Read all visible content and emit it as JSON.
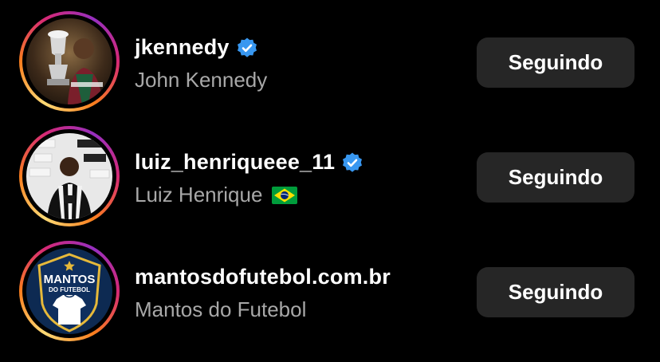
{
  "accounts": [
    {
      "username": "jkennedy",
      "full_name": "John Kennedy",
      "verified": true,
      "button_label": "Seguindo"
    },
    {
      "username": "luiz_henriqueee_11",
      "full_name": "Luiz Henrique",
      "flag": "brazil-flag-icon",
      "verified": true,
      "button_label": "Seguindo"
    },
    {
      "username": "mantosdofutebol.com.br",
      "full_name": "Mantos do Futebol",
      "verified": false,
      "button_label": "Seguindo",
      "avatar_logo_text": "MANTOS DO FUTEBOL"
    }
  ],
  "colors": {
    "background": "#000000",
    "button_bg": "#262626",
    "secondary_text": "#a8a8a8",
    "verified_blue": "#3897f0"
  }
}
